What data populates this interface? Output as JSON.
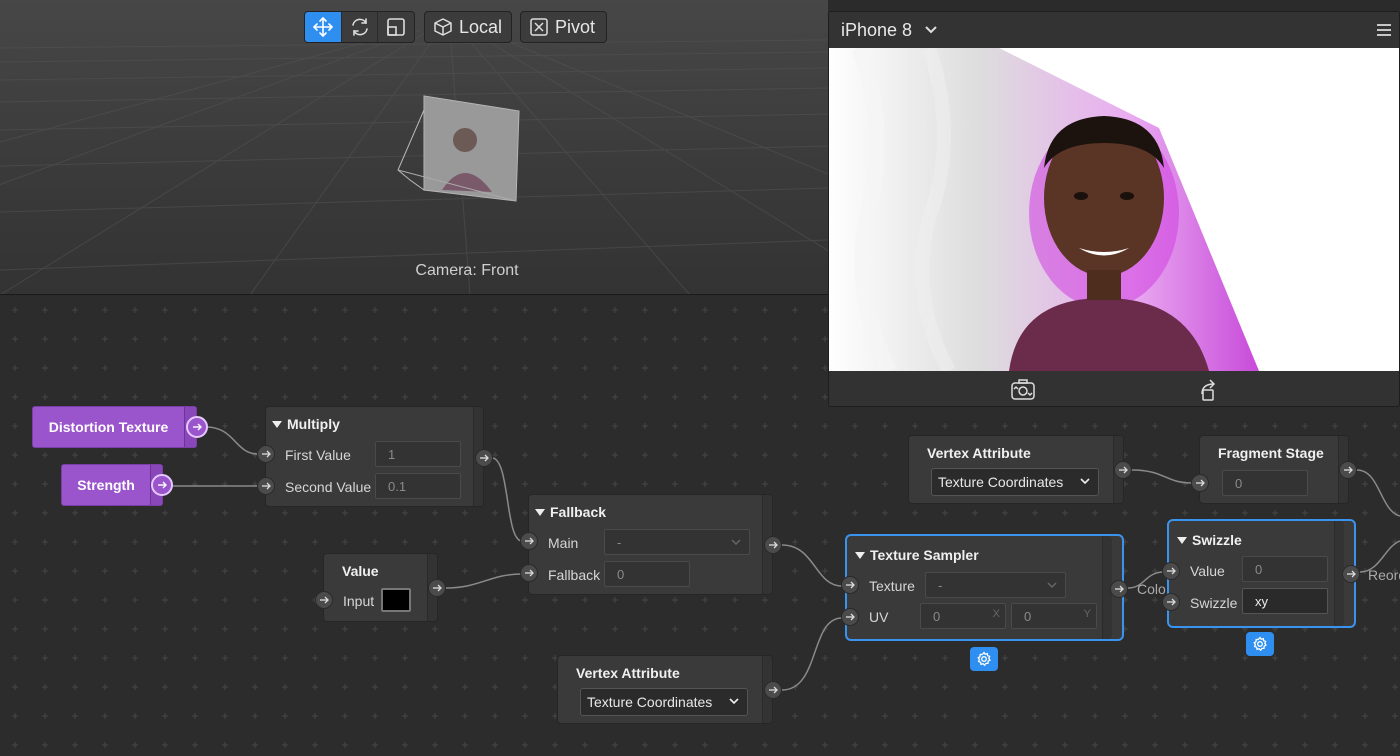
{
  "toolbar": {
    "local_label": "Local",
    "pivot_label": "Pivot"
  },
  "viewport": {
    "camera_label": "Camera: Front"
  },
  "preview": {
    "device": "iPhone 8"
  },
  "nodes": {
    "distortion_texture": {
      "title": "Distortion Texture"
    },
    "strength": {
      "title": "Strength"
    },
    "multiply": {
      "title": "Multiply",
      "first_label": "First Value",
      "first_value": "1",
      "second_label": "Second Value",
      "second_value": "0.1"
    },
    "value": {
      "title": "Value",
      "input_label": "Input"
    },
    "fallback": {
      "title": "Fallback",
      "main_label": "Main",
      "main_value": "-",
      "fallback_label": "Fallback",
      "fallback_value": "0"
    },
    "vertex_attr_bottom": {
      "title": "Vertex Attribute",
      "option": "Texture Coordinates"
    },
    "vertex_attr_top": {
      "title": "Vertex Attribute",
      "option": "Texture Coordinates"
    },
    "texture_sampler": {
      "title": "Texture Sampler",
      "texture_label": "Texture",
      "texture_value": "-",
      "uv_label": "UV",
      "uv_x": "0",
      "uv_x_suffix": "X",
      "uv_y": "0",
      "uv_y_suffix": "Y",
      "output_label": "Colo"
    },
    "fragment_stage": {
      "title": "Fragment Stage",
      "value": "0"
    },
    "swizzle": {
      "title": "Swizzle",
      "value_label": "Value",
      "value": "0",
      "swizzle_label": "Swizzle",
      "swizzle_value": "xy",
      "output_label": "Reord"
    }
  },
  "colors": {
    "accent": "#2f8ff0",
    "param_node": "#9b55cc",
    "node_bg": "#3a3a3a"
  }
}
